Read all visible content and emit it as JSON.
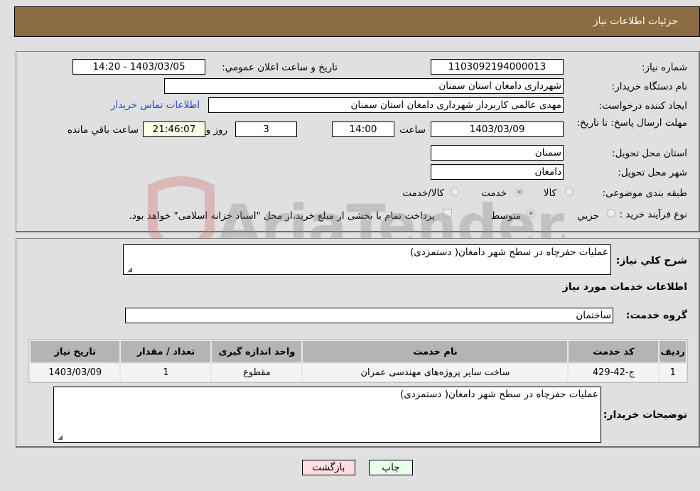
{
  "header": {
    "title": "جزئیات اطلاعات نیاز"
  },
  "details": {
    "need_number_label": "شماره نیاز:",
    "need_number": "1103092194000013",
    "announce_label": "تاريخ و ساعت اعلان عمومي:",
    "announce_value": "1403/03/05 - 14:20",
    "buyer_org_label": "نام دستگاه خریدار:",
    "buyer_org": "شهرداری دامغان استان سمنان",
    "creator_label": "ایجاد کننده درخواست:",
    "creator": "مهدی عالمی کاربرداز شهرداری دامغان استان سمنان",
    "contact_link": "اطلاعات تماس خریدار",
    "deadline_label": "مهلت ارسال پاسخ: تا تاریخ:",
    "deadline_date": "1403/03/09",
    "time_label": "ساعت",
    "deadline_time": "14:00",
    "days_value": "3",
    "days_label": "روز و",
    "remaining_time": "21:46:07",
    "remaining_label": "ساعت باقي مانده",
    "province_label": "استان محل تحویل:",
    "province": "سمنان",
    "city_label": "شهر محل تحویل:",
    "city": "دامغان",
    "category_label": "طبقه بندی موضوعی:",
    "category_options": [
      {
        "label": "کالا",
        "selected": false
      },
      {
        "label": "خدمت",
        "selected": true
      },
      {
        "label": "کالا/خدمت",
        "selected": false
      }
    ],
    "purchase_type_label": "نوع فرآیند خرید :",
    "purchase_type_options": [
      {
        "label": "جزيي",
        "selected": false
      },
      {
        "label": "متوسط",
        "selected": true
      }
    ],
    "treasury_note": "پرداخت تمام یا بخشی از مبلغ خرید،از محل \"اسناد خزانه اسلامی\" خواهد بود.",
    "treasury_checked": false
  },
  "services": {
    "general_desc_label": "شرح کلي نیاز:",
    "general_desc": "عملیات حفرچاه در سطح شهر دامغان( دستمزدی)",
    "section_title": "اطلاعات خدمات مورد نیاز",
    "group_label": "گروه خدمت:",
    "group_value": "ساختمان",
    "table": {
      "columns": [
        "ردیف",
        "کد خدمت",
        "نام خدمت",
        "واحد اندازه گیری",
        "تعداد / مقدار",
        "تاریخ نیاز"
      ],
      "rows": [
        [
          "1",
          "ج-42-429",
          "ساخت سایر پروژه‌های مهندسی عمران",
          "مقطوع",
          "1",
          "1403/03/09"
        ]
      ]
    },
    "buyer_notes_label": "توضیحات خریدار:",
    "buyer_notes": "عملیات حفرچاه در سطح شهر دامغان( دستمزدی)"
  },
  "buttons": {
    "print": "چاپ",
    "back": "بازگشت"
  },
  "watermark": {
    "text": "AriaTender.neT"
  },
  "colors": {
    "header_bg": "#8b6b41",
    "link": "#2a3fd0",
    "print_bg": "#eaffea",
    "back_bg": "#ffe0e0"
  }
}
